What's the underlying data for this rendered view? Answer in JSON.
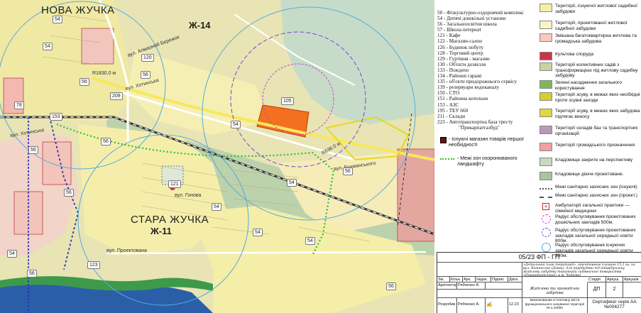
{
  "map": {
    "districts": [
      "НОВА ЖУЧКА",
      "СТАРА ЖУЧКА"
    ],
    "zones": [
      "Ж-14",
      "Ж-11"
    ],
    "streets": [
      "вул. Алмазний Бережок",
      "вул. Хотинська",
      "вул. Хотинська",
      "вул. Бучманського",
      "вул. Гонова",
      "вул. Проектована"
    ],
    "radius_labels": [
      "R1830.0 м",
      "R636.0 м"
    ],
    "numbers": [
      "54",
      "54",
      "56",
      "120",
      "56",
      "209",
      "78",
      "153",
      "56",
      "56",
      "56",
      "54",
      "54",
      "105",
      "54",
      "56",
      "54",
      "54",
      "56",
      "54",
      "56",
      "123",
      "121"
    ]
  },
  "codes": [
    "50 - Фізкультурно-оздоровчий комплекс",
    "54 - Дитячі дошкільні установи",
    "56 - Загальноосвітня школа",
    "57 - Школа-інтернат",
    "121 - Кафе",
    "122 - Магазин-салон",
    "126 - Будинок побуту",
    "128 - Торговий центр",
    "129 - Гуртівня - магазин",
    "130 - Об'єкти дозвілля",
    "133 - Пождепо",
    "134 - Районні гаражі",
    "135 - об'єкти придорожнього сервісу",
    "139 - резервуари водоканалу",
    "150 - СТО",
    "151 - Районна котельня",
    "153 - АЗС",
    "195 - ТЕУ 660",
    "211 - Склади",
    "223 - Автотранспортна база тресту",
    "\"Прикарпатгазбуд\""
  ],
  "inline_legend": [
    "- Існуючі магазин товарів першої необхідності",
    "- Межі зон охоронюваного ландшафту"
  ],
  "legend": [
    {
      "label": "Території, існуючої житлової садибної забудови",
      "color": "#f5eeaa"
    },
    {
      "label": "Території, проектованої житлової садибної забудови",
      "color": "#faf3c6"
    },
    {
      "label": "Змішана багатоквартирна житлова та громадська забудова",
      "color": "#f7c9bf"
    },
    {
      "label": "Культова споруда",
      "color": "#cc3344"
    },
    {
      "label": "Території колективних садів з трансформацією під житлову садибну забудову",
      "color": "#c8d4a0"
    },
    {
      "label": "Зелені насадження загального користування",
      "color": "#7fb85a"
    },
    {
      "label": "Території зсуву, в межах яких необхідні проти зсувні заходи",
      "color": "#d8d02a"
    },
    {
      "label": "Території зсуву, в межах яких забудова підлягає виносу",
      "color": "#e0d840"
    },
    {
      "label": "Території складів баз та транспортних організацій",
      "color": "#b89ab8"
    },
    {
      "label": "Території громадського призначення",
      "color": "#f0a0a0"
    },
    {
      "label": "Кладовище закрите на перспективу",
      "color": "#c9d8c0"
    },
    {
      "label": "Кладовище діюче проектоване.",
      "color": "#a8c4a0"
    },
    {
      "label": "Межі санітарно захисних зон (існуючі)",
      "color": "#555555"
    },
    {
      "label": "Межі санітарно захисних зон (проект.)",
      "color": "#555555"
    },
    {
      "label": "Амбулаторії загальної практики — сімейної медицини",
      "color": "#cc2222"
    },
    {
      "label": "Радіус обслуговування проектованих дошкільних закладів 500м.",
      "color": "#cc44cc"
    },
    {
      "label": "Радіус обслуговування проектованих закладів загальної середньої освіти 800м.",
      "color": "#7744cc"
    },
    {
      "label": "Радіус обслуговування існуючих закладів загальної середньої освіти 800м.",
      "color": "#55aadd"
    }
  ],
  "stamp": {
    "code": "05/23 ФП - ГП",
    "description": "«Детальний план території», орієнтовною площею 15,1 га, по вул. Хотинська (Довга), для перебудівні під індивідуальну житлову забудову територій садівничого товариства «Прикарпатський» в м. Чернівці",
    "headers": [
      "Зм.",
      "Кільк.",
      "Арк.",
      "№док.",
      "Підпис",
      "Дата"
    ],
    "rows": [
      {
        "role": "Архітектор",
        "name": "Рябченко А."
      },
      {
        "role": "Розробив",
        "name": "Рябченко А."
      }
    ],
    "sheet_title": "Житлова та громадська забудова",
    "col_labels": [
      "Стадія",
      "Аркуш",
      "Аркушів"
    ],
    "stage": "ДП",
    "sheet": "2",
    "sheet_count": "",
    "date": "12.23",
    "bottom_text": "Виконкование в генплану міста функціонального зонування території М-1:10000",
    "certificate": "Сертифікат серія АА №004277"
  }
}
